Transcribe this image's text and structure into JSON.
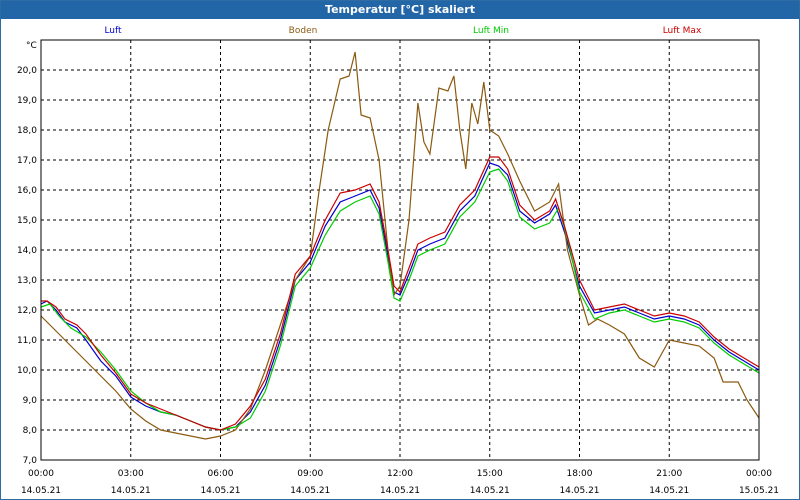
{
  "window": {
    "title": "Temperatur [°C] skaliert",
    "title_bar_color": "#2366a8"
  },
  "chart_data": {
    "type": "line",
    "title": "Temperatur [°C] skaliert",
    "ylabel": "°C",
    "ylim": [
      7.0,
      21.0
    ],
    "yticks": [
      "7,0",
      "8,0",
      "9,0",
      "10,0",
      "11,0",
      "12,0",
      "13,0",
      "14,0",
      "15,0",
      "16,0",
      "17,0",
      "18,0",
      "19,0",
      "20,0"
    ],
    "xlim": [
      0,
      24
    ],
    "xticks": [
      {
        "x": 0,
        "time": "00:00",
        "date": "14.05.21"
      },
      {
        "x": 3,
        "time": "03:00",
        "date": "14.05.21"
      },
      {
        "x": 6,
        "time": "06:00",
        "date": "14.05.21"
      },
      {
        "x": 9,
        "time": "09:00",
        "date": "14.05.21"
      },
      {
        "x": 12,
        "time": "12:00",
        "date": "14.05.21"
      },
      {
        "x": 15,
        "time": "15:00",
        "date": "14.05.21"
      },
      {
        "x": 18,
        "time": "18:00",
        "date": "14.05.21"
      },
      {
        "x": 21,
        "time": "21:00",
        "date": "14.05.21"
      },
      {
        "x": 24,
        "time": "00:00",
        "date": "15.05.21"
      }
    ],
    "grid": true,
    "legend_position": "top",
    "series": [
      {
        "name": "Luft",
        "color": "#0000cc",
        "points": [
          [
            0,
            12.2
          ],
          [
            0.2,
            12.3
          ],
          [
            0.5,
            12.0
          ],
          [
            0.8,
            11.6
          ],
          [
            1.2,
            11.4
          ],
          [
            1.5,
            11.0
          ],
          [
            2.0,
            10.3
          ],
          [
            2.5,
            9.8
          ],
          [
            3.0,
            9.1
          ],
          [
            3.5,
            8.8
          ],
          [
            4.0,
            8.6
          ],
          [
            4.5,
            8.5
          ],
          [
            5.0,
            8.3
          ],
          [
            5.5,
            8.1
          ],
          [
            6.0,
            8.0
          ],
          [
            6.5,
            8.1
          ],
          [
            7.0,
            8.6
          ],
          [
            7.5,
            9.5
          ],
          [
            8.0,
            11.0
          ],
          [
            8.5,
            13.0
          ],
          [
            9.0,
            13.6
          ],
          [
            9.5,
            14.8
          ],
          [
            10.0,
            15.6
          ],
          [
            10.5,
            15.8
          ],
          [
            11.0,
            16.0
          ],
          [
            11.3,
            15.4
          ],
          [
            11.6,
            13.8
          ],
          [
            11.8,
            12.6
          ],
          [
            12.0,
            12.5
          ],
          [
            12.3,
            13.2
          ],
          [
            12.6,
            14.0
          ],
          [
            13.0,
            14.2
          ],
          [
            13.5,
            14.4
          ],
          [
            14.0,
            15.3
          ],
          [
            14.5,
            15.8
          ],
          [
            15.0,
            16.9
          ],
          [
            15.3,
            16.8
          ],
          [
            15.6,
            16.5
          ],
          [
            16.0,
            15.3
          ],
          [
            16.5,
            14.9
          ],
          [
            17.0,
            15.2
          ],
          [
            17.2,
            15.5
          ],
          [
            17.5,
            14.6
          ],
          [
            18.0,
            12.8
          ],
          [
            18.5,
            11.9
          ],
          [
            19.0,
            12.0
          ],
          [
            19.5,
            12.1
          ],
          [
            20.0,
            11.9
          ],
          [
            20.5,
            11.7
          ],
          [
            21.0,
            11.8
          ],
          [
            21.5,
            11.7
          ],
          [
            22.0,
            11.5
          ],
          [
            22.5,
            11.0
          ],
          [
            23.0,
            10.6
          ],
          [
            23.5,
            10.3
          ],
          [
            24.0,
            10.0
          ]
        ]
      },
      {
        "name": "Boden",
        "color": "#8b5a10",
        "points": [
          [
            0,
            11.8
          ],
          [
            0.5,
            11.3
          ],
          [
            1.0,
            10.8
          ],
          [
            1.5,
            10.3
          ],
          [
            2.0,
            9.8
          ],
          [
            2.5,
            9.3
          ],
          [
            3.0,
            8.7
          ],
          [
            3.5,
            8.3
          ],
          [
            4.0,
            8.0
          ],
          [
            4.5,
            7.9
          ],
          [
            5.0,
            7.8
          ],
          [
            5.5,
            7.7
          ],
          [
            6.0,
            7.8
          ],
          [
            6.5,
            8.0
          ],
          [
            7.0,
            8.7
          ],
          [
            7.5,
            10.0
          ],
          [
            8.0,
            11.5
          ],
          [
            8.5,
            13.0
          ],
          [
            9.0,
            13.8
          ],
          [
            9.3,
            16.0
          ],
          [
            9.6,
            18.0
          ],
          [
            10.0,
            19.7
          ],
          [
            10.3,
            19.8
          ],
          [
            10.5,
            20.6
          ],
          [
            10.7,
            18.5
          ],
          [
            11.0,
            18.4
          ],
          [
            11.3,
            17.0
          ],
          [
            11.6,
            14.0
          ],
          [
            11.8,
            12.5
          ],
          [
            12.0,
            12.8
          ],
          [
            12.3,
            15.0
          ],
          [
            12.6,
            18.9
          ],
          [
            12.8,
            17.6
          ],
          [
            13.0,
            17.2
          ],
          [
            13.3,
            19.4
          ],
          [
            13.6,
            19.3
          ],
          [
            13.8,
            19.8
          ],
          [
            14.0,
            18.0
          ],
          [
            14.2,
            16.7
          ],
          [
            14.4,
            18.9
          ],
          [
            14.6,
            18.2
          ],
          [
            14.8,
            19.6
          ],
          [
            15.0,
            18.0
          ],
          [
            15.3,
            17.8
          ],
          [
            15.6,
            17.2
          ],
          [
            16.0,
            16.3
          ],
          [
            16.5,
            15.3
          ],
          [
            17.0,
            15.6
          ],
          [
            17.3,
            16.2
          ],
          [
            17.6,
            14.0
          ],
          [
            18.0,
            12.5
          ],
          [
            18.3,
            11.5
          ],
          [
            18.6,
            11.7
          ],
          [
            19.0,
            11.5
          ],
          [
            19.5,
            11.2
          ],
          [
            20.0,
            10.4
          ],
          [
            20.5,
            10.1
          ],
          [
            21.0,
            11.0
          ],
          [
            21.5,
            10.9
          ],
          [
            22.0,
            10.8
          ],
          [
            22.5,
            10.4
          ],
          [
            22.8,
            9.6
          ],
          [
            23.3,
            9.6
          ],
          [
            23.6,
            9.0
          ],
          [
            24.0,
            8.4
          ]
        ]
      },
      {
        "name": "Luft Min",
        "color": "#00cc00",
        "points": [
          [
            0,
            12.1
          ],
          [
            0.3,
            12.2
          ],
          [
            0.6,
            11.8
          ],
          [
            1.0,
            11.4
          ],
          [
            1.5,
            11.1
          ],
          [
            2.0,
            10.6
          ],
          [
            2.5,
            10.0
          ],
          [
            3.0,
            9.3
          ],
          [
            3.5,
            8.9
          ],
          [
            4.0,
            8.6
          ],
          [
            4.5,
            8.5
          ],
          [
            5.0,
            8.3
          ],
          [
            5.5,
            8.1
          ],
          [
            6.0,
            8.0
          ],
          [
            6.5,
            8.1
          ],
          [
            7.0,
            8.4
          ],
          [
            7.5,
            9.3
          ],
          [
            8.0,
            10.8
          ],
          [
            8.5,
            12.8
          ],
          [
            9.0,
            13.4
          ],
          [
            9.5,
            14.5
          ],
          [
            10.0,
            15.3
          ],
          [
            10.5,
            15.6
          ],
          [
            11.0,
            15.8
          ],
          [
            11.3,
            15.2
          ],
          [
            11.6,
            13.6
          ],
          [
            11.8,
            12.4
          ],
          [
            12.0,
            12.3
          ],
          [
            12.3,
            13.0
          ],
          [
            12.6,
            13.8
          ],
          [
            13.0,
            14.0
          ],
          [
            13.5,
            14.2
          ],
          [
            14.0,
            15.1
          ],
          [
            14.5,
            15.6
          ],
          [
            15.0,
            16.6
          ],
          [
            15.3,
            16.7
          ],
          [
            15.6,
            16.3
          ],
          [
            16.0,
            15.1
          ],
          [
            16.5,
            14.7
          ],
          [
            17.0,
            14.9
          ],
          [
            17.3,
            15.4
          ],
          [
            17.6,
            14.4
          ],
          [
            18.0,
            12.6
          ],
          [
            18.5,
            11.7
          ],
          [
            19.0,
            11.9
          ],
          [
            19.5,
            12.0
          ],
          [
            20.0,
            11.8
          ],
          [
            20.5,
            11.6
          ],
          [
            21.0,
            11.7
          ],
          [
            21.5,
            11.6
          ],
          [
            22.0,
            11.4
          ],
          [
            22.5,
            10.9
          ],
          [
            23.0,
            10.5
          ],
          [
            23.5,
            10.2
          ],
          [
            24.0,
            9.9
          ]
        ]
      },
      {
        "name": "Luft Max",
        "color": "#cc0000",
        "points": [
          [
            0,
            12.3
          ],
          [
            0.2,
            12.3
          ],
          [
            0.5,
            12.1
          ],
          [
            0.8,
            11.7
          ],
          [
            1.2,
            11.5
          ],
          [
            1.5,
            11.2
          ],
          [
            2.0,
            10.5
          ],
          [
            2.5,
            9.9
          ],
          [
            3.0,
            9.2
          ],
          [
            3.5,
            8.9
          ],
          [
            4.0,
            8.7
          ],
          [
            4.5,
            8.5
          ],
          [
            5.0,
            8.3
          ],
          [
            5.5,
            8.1
          ],
          [
            6.0,
            8.0
          ],
          [
            6.5,
            8.2
          ],
          [
            7.0,
            8.8
          ],
          [
            7.5,
            9.7
          ],
          [
            8.0,
            11.2
          ],
          [
            8.5,
            13.2
          ],
          [
            9.0,
            13.8
          ],
          [
            9.5,
            15.0
          ],
          [
            10.0,
            15.9
          ],
          [
            10.5,
            16.0
          ],
          [
            11.0,
            16.2
          ],
          [
            11.3,
            15.6
          ],
          [
            11.6,
            14.0
          ],
          [
            11.8,
            12.8
          ],
          [
            12.0,
            12.6
          ],
          [
            12.3,
            13.4
          ],
          [
            12.6,
            14.2
          ],
          [
            13.0,
            14.4
          ],
          [
            13.5,
            14.6
          ],
          [
            14.0,
            15.5
          ],
          [
            14.5,
            16.0
          ],
          [
            15.0,
            17.1
          ],
          [
            15.3,
            17.1
          ],
          [
            15.6,
            16.7
          ],
          [
            16.0,
            15.5
          ],
          [
            16.5,
            15.0
          ],
          [
            17.0,
            15.3
          ],
          [
            17.2,
            15.7
          ],
          [
            17.5,
            14.8
          ],
          [
            18.0,
            13.0
          ],
          [
            18.5,
            12.0
          ],
          [
            19.0,
            12.1
          ],
          [
            19.5,
            12.2
          ],
          [
            20.0,
            12.0
          ],
          [
            20.5,
            11.8
          ],
          [
            21.0,
            11.9
          ],
          [
            21.5,
            11.8
          ],
          [
            22.0,
            11.6
          ],
          [
            22.5,
            11.1
          ],
          [
            23.0,
            10.7
          ],
          [
            23.5,
            10.4
          ],
          [
            24.0,
            10.1
          ]
        ]
      }
    ]
  }
}
